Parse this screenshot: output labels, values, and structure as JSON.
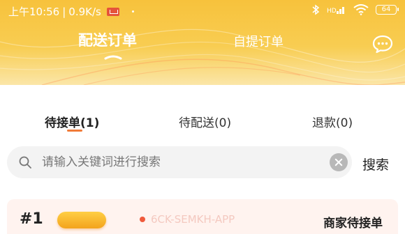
{
  "statusbar": {
    "time": "上午10:56",
    "separator": "|",
    "speed": "0.9K/s",
    "battery": "64",
    "icons": [
      "mail-icon",
      "bluetooth-icon",
      "signal-icon",
      "wifi-icon",
      "battery-icon"
    ]
  },
  "top_tabs": [
    {
      "label": "配送订单",
      "active": true
    },
    {
      "label": "自提订单",
      "active": false
    }
  ],
  "sub_tabs": [
    {
      "label": "待接单(1)",
      "active": true
    },
    {
      "label": "待配送(0)",
      "active": false
    },
    {
      "label": "退款(0)",
      "active": false
    }
  ],
  "search": {
    "placeholder": "请输入关键词进行搜索",
    "value": "",
    "button_label": "搜索"
  },
  "order": {
    "number": "#1",
    "tag": "",
    "watermark": "6CK-SEMKH-APP",
    "status": "商家待接单"
  },
  "colors": {
    "header_yellow": "#f7c23c",
    "accent_orange": "#f07b38",
    "card_bg": "#fff3ef"
  }
}
